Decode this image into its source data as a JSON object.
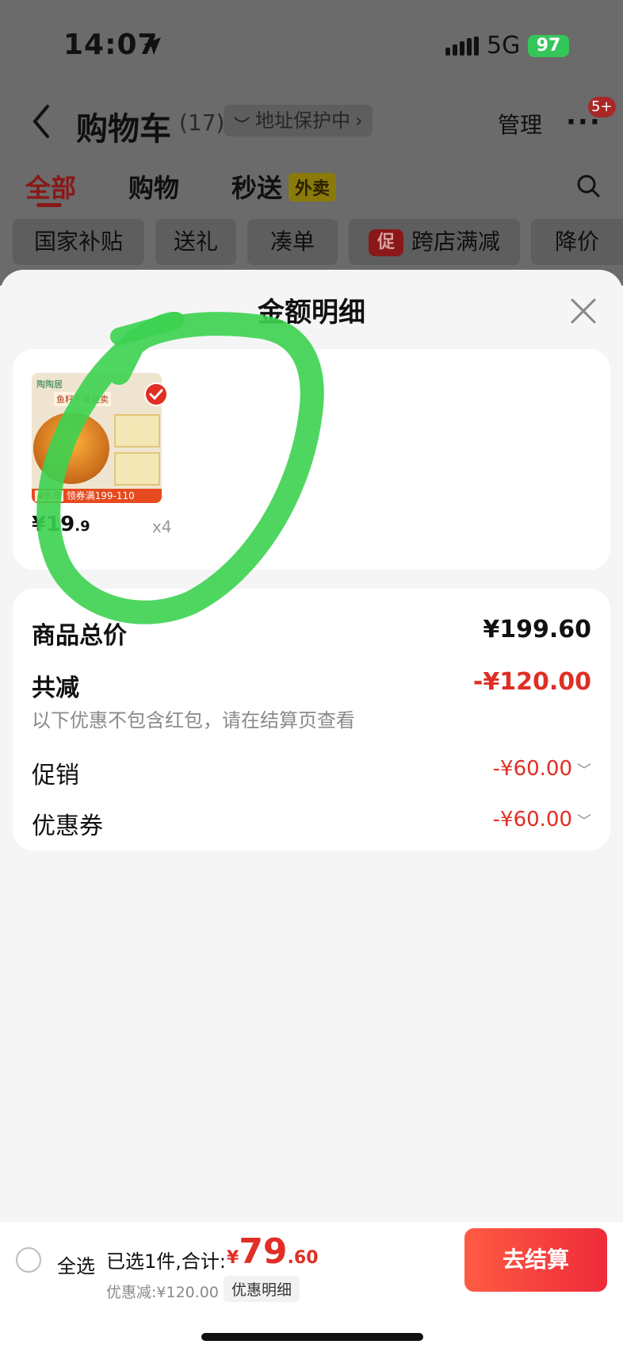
{
  "status_bar": {
    "time": "14:07",
    "network": "5G",
    "battery": "97"
  },
  "header": {
    "title": "购物车",
    "count": "(17)",
    "address": "地址保护中",
    "manage": "管理",
    "badge": "5+"
  },
  "tabs": [
    {
      "label": "全部",
      "active": true
    },
    {
      "label": "购物"
    },
    {
      "label": "秒送"
    }
  ],
  "tab_tag": "外卖",
  "chips": [
    "国家补贴",
    "送礼",
    "凑单",
    "跨店满减",
    "降价"
  ],
  "chip_icon_text": "促",
  "sheet": {
    "title": "金额明细"
  },
  "product": {
    "price_int": "¥19",
    "price_dec": ".9",
    "qty": "x4",
    "thumb_logo": "陶陶居",
    "thumb_tag": "鱼籽干蒸烧卖",
    "thumb_price": "49.9",
    "thumb_coupon": "领券满199-110"
  },
  "summary": {
    "total_label": "商品总价",
    "total_value": "¥199.60",
    "discount_label": "共减",
    "discount_value": "-¥120.00",
    "note": "以下优惠不包含红包，请在结算页查看",
    "promo_label": "促销",
    "promo_value": "-¥60.00",
    "coupon_label": "优惠券",
    "coupon_value": "-¥60.00"
  },
  "bottom": {
    "select_all": "全选",
    "selected_info": "已选1件,合计:",
    "currency": "¥",
    "total_int": "79",
    "total_dec": ".60",
    "discount_text": "优惠减:¥120.00",
    "detail_button": "优惠明细",
    "checkout": "去结算"
  },
  "colors": {
    "accent_red": "#e02e24",
    "highlight_green": "#3cd150",
    "battery_green": "#35c659"
  }
}
